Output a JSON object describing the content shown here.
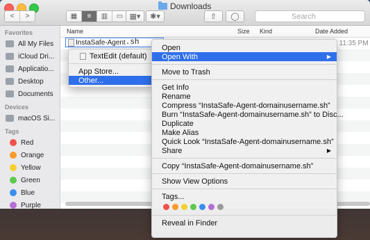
{
  "window": {
    "title": "Downloads"
  },
  "toolbar": {
    "back": "<",
    "forward": ">",
    "view_icons": [
      "▦",
      "≡",
      "▥",
      "▭"
    ],
    "arrange": "▦▾",
    "action": "✱▾",
    "share": "⇧",
    "tags": "◯",
    "search_placeholder": "Search"
  },
  "sidebar": {
    "favorites_header": "Favorites",
    "favorites": [
      {
        "label": "All My Files",
        "icon": "all-files-icon"
      },
      {
        "label": "iCloud Dri...",
        "icon": "cloud-icon"
      },
      {
        "label": "Applicatio...",
        "icon": "applications-icon"
      },
      {
        "label": "Desktop",
        "icon": "desktop-icon"
      },
      {
        "label": "Documents",
        "icon": "documents-icon"
      }
    ],
    "devices_header": "Devices",
    "devices": [
      {
        "label": "macOS Si...",
        "icon": "disk-icon"
      }
    ],
    "tags_header": "Tags",
    "tags": [
      {
        "label": "Red",
        "color": "#f0504b"
      },
      {
        "label": "Orange",
        "color": "#f79a2b"
      },
      {
        "label": "Yellow",
        "color": "#f5cf2f"
      },
      {
        "label": "Green",
        "color": "#5fc84e"
      },
      {
        "label": "Blue",
        "color": "#3a8ef0"
      },
      {
        "label": "Purple",
        "color": "#b46fd6"
      }
    ]
  },
  "columns": {
    "name": "Name",
    "size": "Size",
    "kind": "Kind",
    "date": "Date Added"
  },
  "file": {
    "name": "InstaSafe-Agent",
    "ext": ".sh",
    "date_partial": "Today, 11:35 PM"
  },
  "submenu": {
    "items": [
      "TextEdit (default)",
      "App Store...",
      "Other..."
    ]
  },
  "context_menu": {
    "open": "Open",
    "open_with": "Open With",
    "move_to_trash": "Move to Trash",
    "get_info": "Get Info",
    "rename": "Rename",
    "compress": "Compress “InstaSafe-Agent-domainusername.sh”",
    "burn": "Burn “InstaSafe-Agent-domainusername.sh” to Disc...",
    "duplicate": "Duplicate",
    "make_alias": "Make Alias",
    "quick_look": "Quick Look “InstaSafe-Agent-domainusername.sh”",
    "share": "Share",
    "copy": "Copy “InstaSafe-Agent-domainusername.sh”",
    "show_view_options": "Show View Options",
    "tags": "Tags...",
    "tag_colors": [
      "#f0504b",
      "#f79a2b",
      "#f5cf2f",
      "#5fc84e",
      "#3a8ef0",
      "#b46fd6",
      "#9a9a9a"
    ],
    "reveal": "Reveal in Finder"
  }
}
